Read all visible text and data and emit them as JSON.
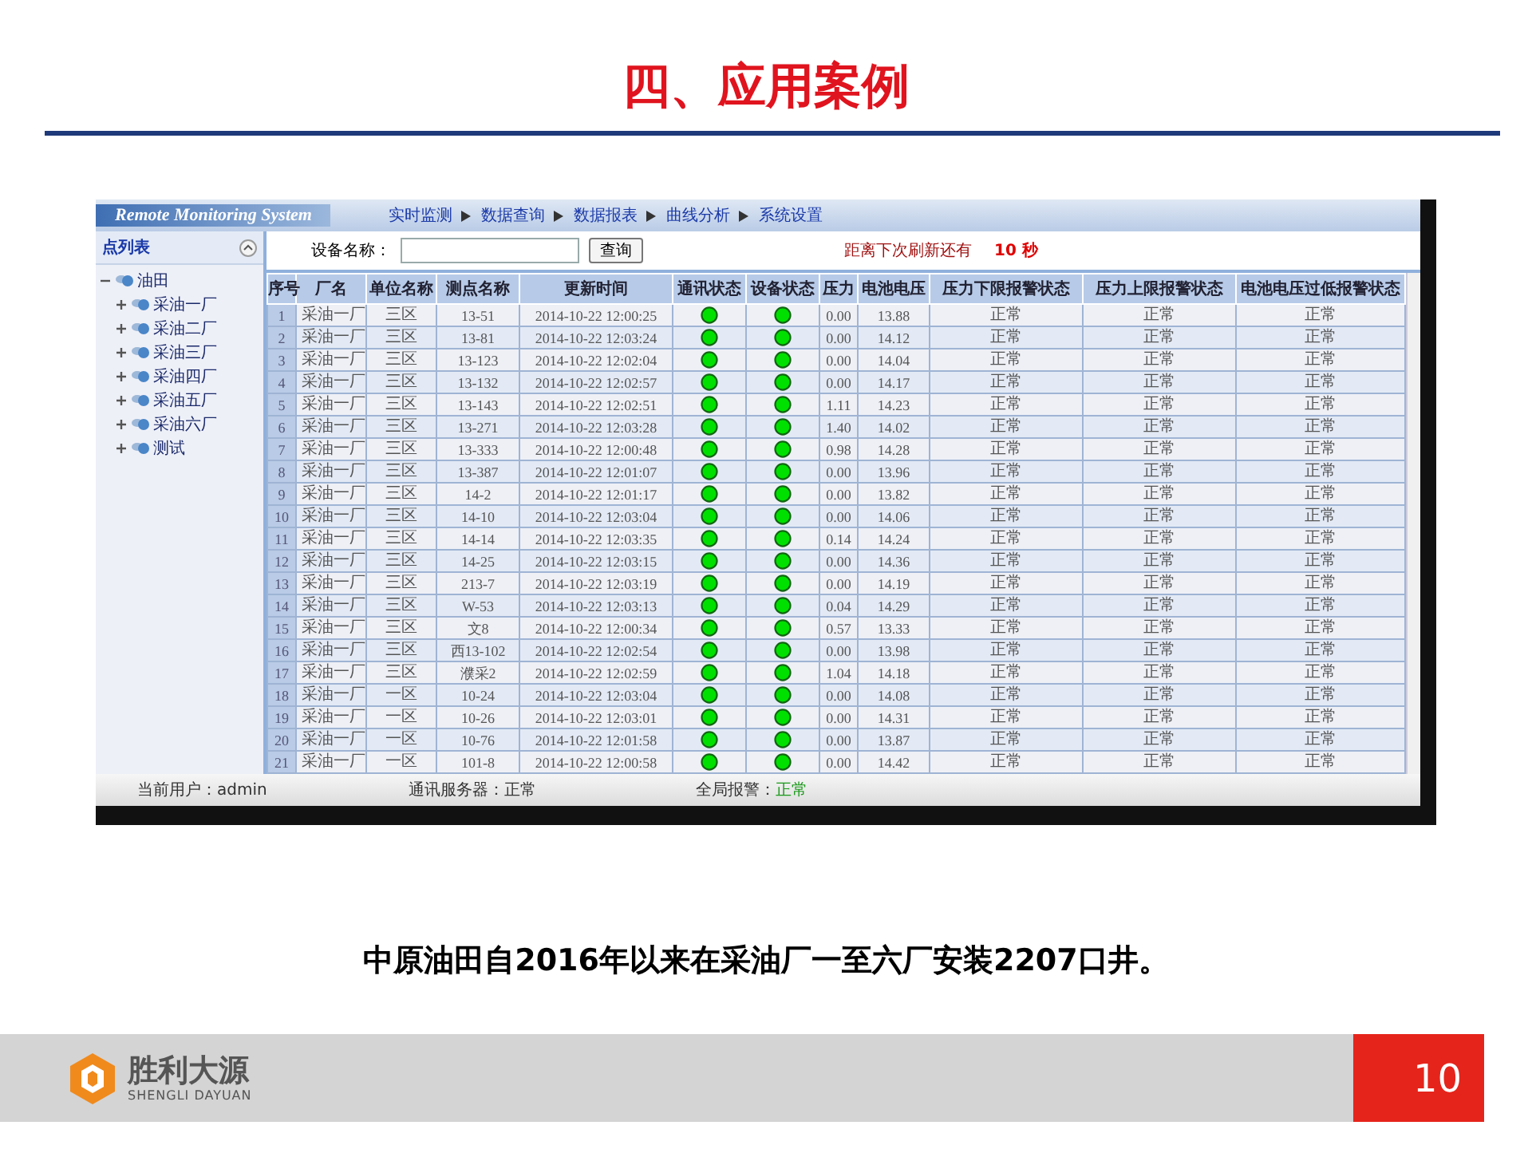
{
  "slide_title": "四、应用案例",
  "app": {
    "logo": "Remote Monitoring System",
    "nav": [
      "实时监测",
      "数据查询",
      "数据报表",
      "曲线分析",
      "系统设置"
    ],
    "sidebar": {
      "title": "点列表",
      "tree": [
        {
          "label": "油田",
          "expanded": true,
          "children": [
            {
              "label": "采油一厂",
              "expanded": false
            },
            {
              "label": "采油二厂",
              "expanded": false
            },
            {
              "label": "采油三厂",
              "expanded": false
            },
            {
              "label": "采油四厂",
              "expanded": false
            },
            {
              "label": "采油五厂",
              "expanded": false
            },
            {
              "label": "采油六厂",
              "expanded": false
            },
            {
              "label": "测试",
              "expanded": false
            }
          ]
        }
      ]
    },
    "search": {
      "label": "设备名称：",
      "button": "查询",
      "refresh_label": "距离下次刷新还有",
      "refresh_value": "10 秒"
    },
    "table": {
      "columns": [
        "序号",
        "厂名",
        "单位名称",
        "测点名称",
        "更新时间",
        "通讯状态",
        "设备状态",
        "压力",
        "电池电压",
        "压力下限报警状态",
        "压力上限报警状态",
        "电池电压过低报警状态"
      ],
      "rows": [
        {
          "no": "1",
          "plant": "采油一厂",
          "unit": "三区",
          "point": "13-51",
          "time": "2014-10-22 12:00:25",
          "comm_ok": true,
          "device_ok": true,
          "pressure": "0.00",
          "battery": "13.88",
          "low_alarm": "正常",
          "high_alarm": "正常",
          "battery_alarm": "正常"
        },
        {
          "no": "2",
          "plant": "采油一厂",
          "unit": "三区",
          "point": "13-81",
          "time": "2014-10-22 12:03:24",
          "comm_ok": true,
          "device_ok": true,
          "pressure": "0.00",
          "battery": "14.12",
          "low_alarm": "正常",
          "high_alarm": "正常",
          "battery_alarm": "正常"
        },
        {
          "no": "3",
          "plant": "采油一厂",
          "unit": "三区",
          "point": "13-123",
          "time": "2014-10-22 12:02:04",
          "comm_ok": true,
          "device_ok": true,
          "pressure": "0.00",
          "battery": "14.04",
          "low_alarm": "正常",
          "high_alarm": "正常",
          "battery_alarm": "正常"
        },
        {
          "no": "4",
          "plant": "采油一厂",
          "unit": "三区",
          "point": "13-132",
          "time": "2014-10-22 12:02:57",
          "comm_ok": true,
          "device_ok": true,
          "pressure": "0.00",
          "battery": "14.17",
          "low_alarm": "正常",
          "high_alarm": "正常",
          "battery_alarm": "正常"
        },
        {
          "no": "5",
          "plant": "采油一厂",
          "unit": "三区",
          "point": "13-143",
          "time": "2014-10-22 12:02:51",
          "comm_ok": true,
          "device_ok": true,
          "pressure": "1.11",
          "battery": "14.23",
          "low_alarm": "正常",
          "high_alarm": "正常",
          "battery_alarm": "正常"
        },
        {
          "no": "6",
          "plant": "采油一厂",
          "unit": "三区",
          "point": "13-271",
          "time": "2014-10-22 12:03:28",
          "comm_ok": true,
          "device_ok": true,
          "pressure": "1.40",
          "battery": "14.02",
          "low_alarm": "正常",
          "high_alarm": "正常",
          "battery_alarm": "正常"
        },
        {
          "no": "7",
          "plant": "采油一厂",
          "unit": "三区",
          "point": "13-333",
          "time": "2014-10-22 12:00:48",
          "comm_ok": true,
          "device_ok": true,
          "pressure": "0.98",
          "battery": "14.28",
          "low_alarm": "正常",
          "high_alarm": "正常",
          "battery_alarm": "正常"
        },
        {
          "no": "8",
          "plant": "采油一厂",
          "unit": "三区",
          "point": "13-387",
          "time": "2014-10-22 12:01:07",
          "comm_ok": true,
          "device_ok": true,
          "pressure": "0.00",
          "battery": "13.96",
          "low_alarm": "正常",
          "high_alarm": "正常",
          "battery_alarm": "正常"
        },
        {
          "no": "9",
          "plant": "采油一厂",
          "unit": "三区",
          "point": "14-2",
          "time": "2014-10-22 12:01:17",
          "comm_ok": true,
          "device_ok": true,
          "pressure": "0.00",
          "battery": "13.82",
          "low_alarm": "正常",
          "high_alarm": "正常",
          "battery_alarm": "正常"
        },
        {
          "no": "10",
          "plant": "采油一厂",
          "unit": "三区",
          "point": "14-10",
          "time": "2014-10-22 12:03:04",
          "comm_ok": true,
          "device_ok": true,
          "pressure": "0.00",
          "battery": "14.06",
          "low_alarm": "正常",
          "high_alarm": "正常",
          "battery_alarm": "正常"
        },
        {
          "no": "11",
          "plant": "采油一厂",
          "unit": "三区",
          "point": "14-14",
          "time": "2014-10-22 12:03:35",
          "comm_ok": true,
          "device_ok": true,
          "pressure": "0.14",
          "battery": "14.24",
          "low_alarm": "正常",
          "high_alarm": "正常",
          "battery_alarm": "正常"
        },
        {
          "no": "12",
          "plant": "采油一厂",
          "unit": "三区",
          "point": "14-25",
          "time": "2014-10-22 12:03:15",
          "comm_ok": true,
          "device_ok": true,
          "pressure": "0.00",
          "battery": "14.36",
          "low_alarm": "正常",
          "high_alarm": "正常",
          "battery_alarm": "正常"
        },
        {
          "no": "13",
          "plant": "采油一厂",
          "unit": "三区",
          "point": "213-7",
          "time": "2014-10-22 12:03:19",
          "comm_ok": true,
          "device_ok": true,
          "pressure": "0.00",
          "battery": "14.19",
          "low_alarm": "正常",
          "high_alarm": "正常",
          "battery_alarm": "正常"
        },
        {
          "no": "14",
          "plant": "采油一厂",
          "unit": "三区",
          "point": "W-53",
          "time": "2014-10-22 12:03:13",
          "comm_ok": true,
          "device_ok": true,
          "pressure": "0.04",
          "battery": "14.29",
          "low_alarm": "正常",
          "high_alarm": "正常",
          "battery_alarm": "正常"
        },
        {
          "no": "15",
          "plant": "采油一厂",
          "unit": "三区",
          "point": "文8",
          "time": "2014-10-22 12:00:34",
          "comm_ok": true,
          "device_ok": true,
          "pressure": "0.57",
          "battery": "13.33",
          "low_alarm": "正常",
          "high_alarm": "正常",
          "battery_alarm": "正常"
        },
        {
          "no": "16",
          "plant": "采油一厂",
          "unit": "三区",
          "point": "西13-102",
          "time": "2014-10-22 12:02:54",
          "comm_ok": true,
          "device_ok": true,
          "pressure": "0.00",
          "battery": "13.98",
          "low_alarm": "正常",
          "high_alarm": "正常",
          "battery_alarm": "正常"
        },
        {
          "no": "17",
          "plant": "采油一厂",
          "unit": "三区",
          "point": "濮采2",
          "time": "2014-10-22 12:02:59",
          "comm_ok": true,
          "device_ok": true,
          "pressure": "1.04",
          "battery": "14.18",
          "low_alarm": "正常",
          "high_alarm": "正常",
          "battery_alarm": "正常"
        },
        {
          "no": "18",
          "plant": "采油一厂",
          "unit": "一区",
          "point": "10-24",
          "time": "2014-10-22 12:03:04",
          "comm_ok": true,
          "device_ok": true,
          "pressure": "0.00",
          "battery": "14.08",
          "low_alarm": "正常",
          "high_alarm": "正常",
          "battery_alarm": "正常"
        },
        {
          "no": "19",
          "plant": "采油一厂",
          "unit": "一区",
          "point": "10-26",
          "time": "2014-10-22 12:03:01",
          "comm_ok": true,
          "device_ok": true,
          "pressure": "0.00",
          "battery": "14.31",
          "low_alarm": "正常",
          "high_alarm": "正常",
          "battery_alarm": "正常"
        },
        {
          "no": "20",
          "plant": "采油一厂",
          "unit": "一区",
          "point": "10-76",
          "time": "2014-10-22 12:01:58",
          "comm_ok": true,
          "device_ok": true,
          "pressure": "0.00",
          "battery": "13.87",
          "low_alarm": "正常",
          "high_alarm": "正常",
          "battery_alarm": "正常"
        },
        {
          "no": "21",
          "plant": "采油一厂",
          "unit": "一区",
          "point": "101-8",
          "time": "2014-10-22 12:00:58",
          "comm_ok": true,
          "device_ok": true,
          "pressure": "0.00",
          "battery": "14.42",
          "low_alarm": "正常",
          "high_alarm": "正常",
          "battery_alarm": "正常"
        }
      ]
    },
    "status_bar": {
      "user": "当前用户：admin",
      "server_label": "通讯服务器：",
      "server_value": "正常",
      "alarm_label": "全局报警：",
      "alarm_value": "正常"
    }
  },
  "caption": "中原油田自2016年以来在采油厂一至六厂安装2207口井。",
  "footer": {
    "logo_cn": "胜利大源",
    "logo_en": "SHENGLI DAYUAN",
    "page": "10"
  }
}
